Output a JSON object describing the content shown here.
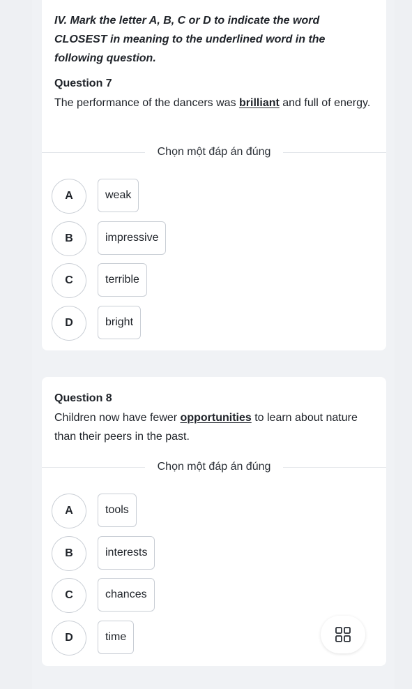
{
  "instruction": "IV. Mark the letter A, B, C or D to indicate the word CLOSEST in meaning to the underlined word in the following question.",
  "questions": [
    {
      "title": "Question 7",
      "text_before": "The performance of the dancers was ",
      "underlined": "brilliant",
      "text_after": " and full of energy.",
      "prompt": "Chọn một đáp án đúng",
      "options": [
        {
          "letter": "A",
          "text": "weak"
        },
        {
          "letter": "B",
          "text": "impressive"
        },
        {
          "letter": "C",
          "text": "terrible"
        },
        {
          "letter": "D",
          "text": "bright"
        }
      ]
    },
    {
      "title": "Question 8",
      "text_before": "Children now have fewer ",
      "underlined": "opportunities",
      "text_after": " to learn about nature than their peers in the past.",
      "prompt": "Chọn một đáp án đúng",
      "options": [
        {
          "letter": "A",
          "text": "tools"
        },
        {
          "letter": "B",
          "text": "interests"
        },
        {
          "letter": "C",
          "text": "chances"
        },
        {
          "letter": "D",
          "text": "time"
        }
      ]
    }
  ],
  "fab": {
    "icon": "grid-icon"
  }
}
